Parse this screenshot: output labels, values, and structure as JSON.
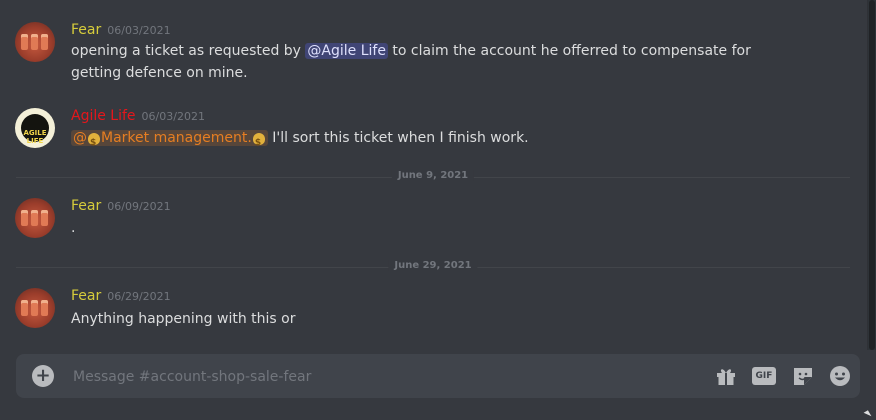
{
  "messages": [
    {
      "author": "Fear",
      "timestamp": "06/03/2021",
      "text_before": "opening a ticket as requested by ",
      "mention": "@Agile Life",
      "text_after": " to claim the account he offerred to compensate for getting defence on mine."
    },
    {
      "author": "Agile Life",
      "avatar_logo_text": "AGILE LIFE",
      "timestamp": "06/03/2021",
      "role_mention": "Market management.",
      "role_mention_prefix": "@",
      "text_after": " I'll sort this ticket when I finish work."
    },
    {
      "author": "Fear",
      "timestamp": "06/09/2021",
      "text": "."
    },
    {
      "author": "Fear",
      "timestamp": "06/29/2021",
      "text": "Anything happening with this or"
    }
  ],
  "dividers": [
    "June 9, 2021",
    "June 29, 2021"
  ],
  "composer": {
    "placeholder": "Message #account-shop-sale-fear",
    "gif_label": "GIF"
  },
  "colors": {
    "background": "#36393f",
    "fear_name": "#d6cc3b",
    "agile_name": "#e5161b",
    "role_mention": "#e67e22",
    "user_mention_bg": "#5865f2"
  },
  "icons": [
    "add-icon",
    "gift-icon",
    "gif-icon",
    "sticker-icon",
    "emoji-icon"
  ]
}
